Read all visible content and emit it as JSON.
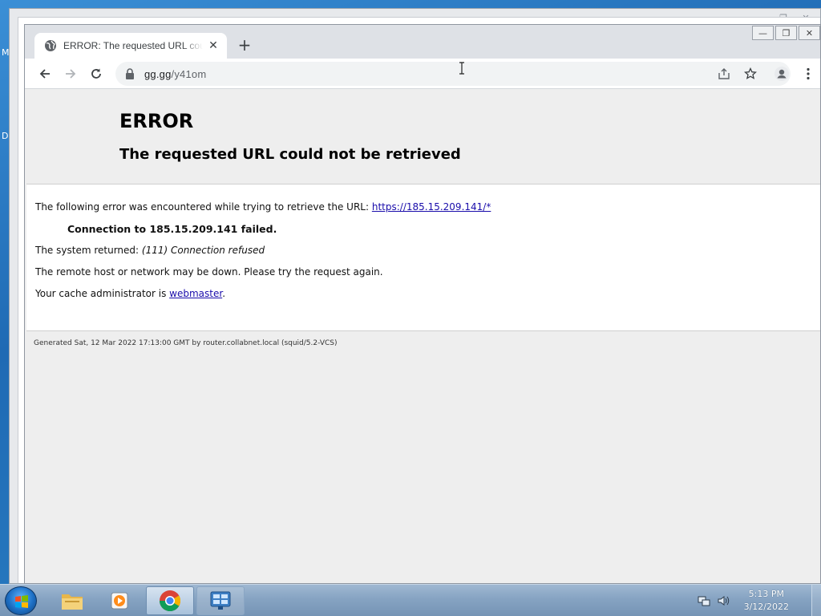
{
  "desktop": {
    "edge_letters": [
      "M",
      "D"
    ]
  },
  "browser": {
    "tab": {
      "title": "ERROR: The requested URL could not be retrieved",
      "close_glyph": "✕"
    },
    "new_tab_glyph": "+",
    "window_controls": {
      "minimize": "—",
      "maximize": "❐",
      "close": "✕"
    },
    "omnibox": {
      "host": "gg.gg",
      "path": "/y41om"
    },
    "icons": [
      "back-arrow-icon",
      "forward-arrow-icon",
      "reload-icon",
      "lock-icon",
      "share-icon",
      "bookmark-star-icon",
      "profile-icon",
      "kebab-menu-icon"
    ]
  },
  "page": {
    "title": "ERROR",
    "subtitle": "The requested URL could not be retrieved",
    "intro": "The following error was encountered while trying to retrieve the URL: ",
    "url_link": "https://185.15.209.141/*",
    "failure": "Connection to 185.15.209.141 failed.",
    "system_returned_label": "The system returned: ",
    "system_returned_value": "(111) Connection refused",
    "remote_down": "The remote host or network may be down. Please try the request again.",
    "admin_prefix": "Your cache administrator is ",
    "admin_link": "webmaster",
    "admin_suffix": ".",
    "footer": "Generated Sat, 12 Mar 2022 17:13:00 GMT by router.collabnet.local (squid/5.2-VCS)"
  },
  "taskbar": {
    "items": [
      "file-explorer",
      "media-player",
      "google-chrome",
      "control-panel"
    ],
    "active_item": "google-chrome",
    "clock_time": "5:13 PM",
    "clock_date": "3/12/2022"
  }
}
